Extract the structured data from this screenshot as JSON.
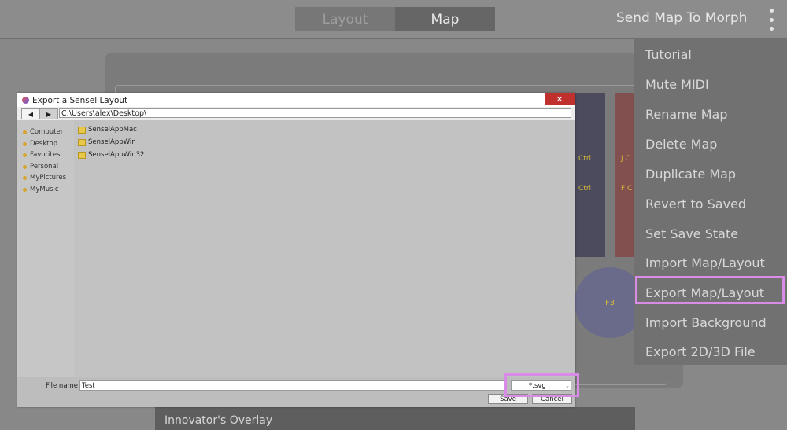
{
  "topbar": {
    "tabs": [
      {
        "label": "Layout",
        "active": false
      },
      {
        "label": "Map",
        "active": true
      }
    ],
    "send_button": "Send Map To Morph",
    "more_icon": "kebab-menu-icon"
  },
  "canvas": {
    "keys": [
      {
        "label_1": "Ctrl",
        "label_2": "Ctrl"
      },
      {
        "label_1": "J C",
        "label_2": "F C"
      }
    ],
    "f3_label": "F3"
  },
  "overlay": {
    "title": "Innovator's Overlay"
  },
  "menu": {
    "items": [
      "Tutorial",
      "Mute MIDI",
      "Rename Map",
      "Delete Map",
      "Duplicate Map",
      "Revert to Saved",
      "Set Save State",
      "Import Map/Layout",
      "Export Map/Layout",
      "Import Background",
      "Export 2D/3D File"
    ],
    "highlighted": "Export Map/Layout"
  },
  "dialog": {
    "title": "Export a Sensel Layout",
    "close_label": "✕",
    "back_label": "◀",
    "forward_label": "▶",
    "path": "C:\\Users\\alex\\Desktop\\",
    "sidebar": [
      "Computer",
      "Desktop",
      "Favorites",
      "Personal",
      "MyPictures",
      "MyMusic"
    ],
    "files": [
      "SenselAppMac",
      "SenselAppWin",
      "SenselAppWin32"
    ],
    "file_name_label": "File name",
    "file_name_value": "Test",
    "filter_value": "*.svg",
    "save_label": "Save",
    "cancel_label": "Cancel"
  },
  "colors": {
    "highlight": "#d98be8",
    "close_button": "#c0302d",
    "accent_text": "#d8b83a"
  }
}
